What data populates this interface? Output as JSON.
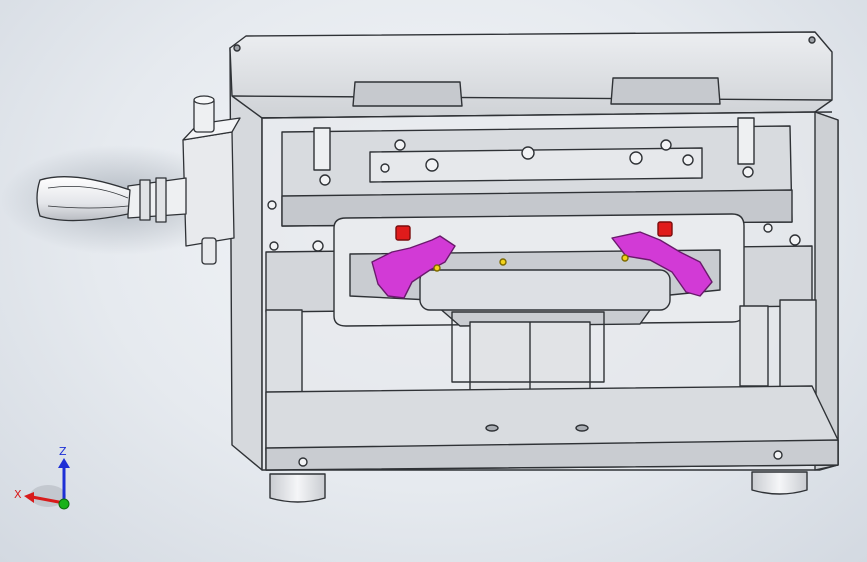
{
  "viewport": {
    "background_colors": [
      "#f4f6f9",
      "#d3d9e1"
    ],
    "part_colors": {
      "housing": "#dfe1e4",
      "edge": "#2f3236",
      "highlight_magenta": "#d23ad6",
      "red_knob": "#e01b1b",
      "yellow_marker": "#f2d21a"
    }
  },
  "triad": {
    "z_label": "Z",
    "x_label": "X",
    "colors": {
      "z": "#1d2fd6",
      "x": "#d81b1b",
      "y": "#19b219"
    }
  }
}
